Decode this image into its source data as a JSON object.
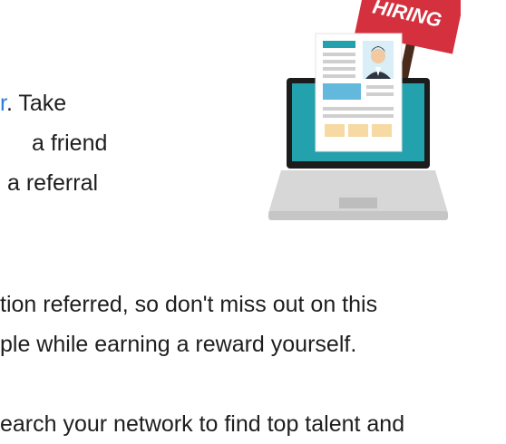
{
  "intro": {
    "link_fragment": "r",
    "line1_rest": ". Take",
    "line2": "a friend",
    "line3": "a referral"
  },
  "paragraph2": {
    "line1": "tion referred, so don't miss out on this",
    "line2": "ple while earning a reward yourself."
  },
  "paragraph3": {
    "line1": "earch your network to find top talent and"
  },
  "illustration": {
    "sign_text_partial": "HIRING",
    "screen_color": "#23a2ad",
    "sign_color": "#d5303e"
  }
}
